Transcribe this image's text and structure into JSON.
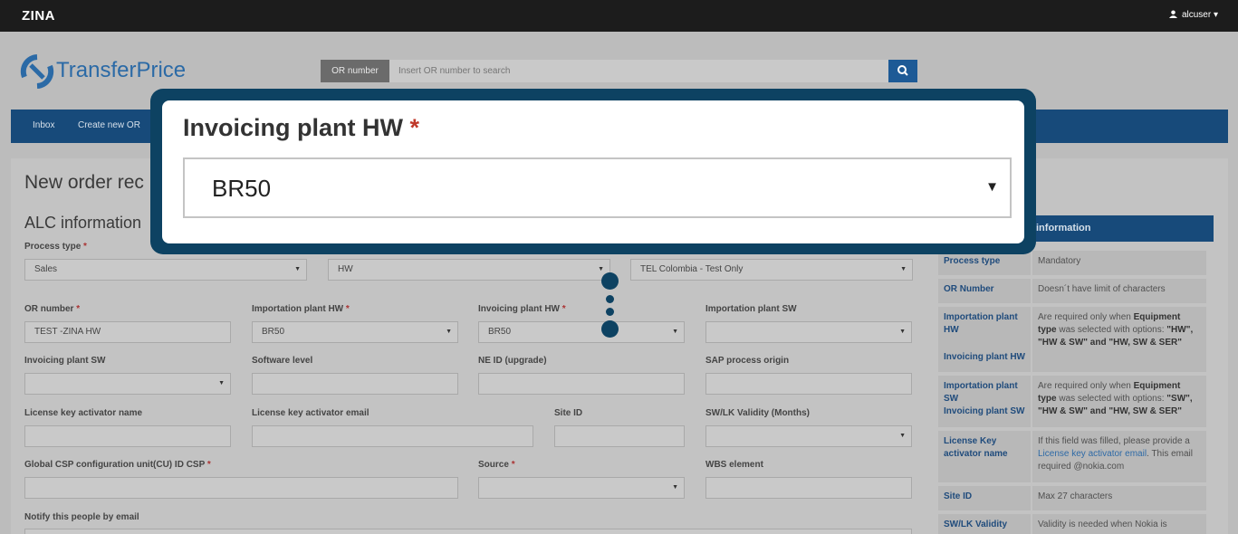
{
  "app": {
    "brand": "ZINA",
    "user": "alcuser ▾"
  },
  "logo": {
    "part1": "Transfer",
    "part2": "Price"
  },
  "search": {
    "label": "OR number",
    "placeholder": "Insert OR number to search"
  },
  "nav": {
    "items": [
      "Inbox",
      "Create new OR"
    ]
  },
  "page": {
    "title": "New order rec",
    "section": "ALC information"
  },
  "form": {
    "process_type": {
      "label": "Process type",
      "value": "Sales"
    },
    "equipment_type": {
      "value": "HW"
    },
    "customer": {
      "value": "TEL Colombia - Test Only"
    },
    "or_number": {
      "label": "OR number",
      "value": "TEST -ZINA HW"
    },
    "importation_plant_hw": {
      "label": "Importation plant HW",
      "value": "BR50"
    },
    "invoicing_plant_hw": {
      "label": "Invoicing plant HW",
      "value": "BR50"
    },
    "importation_plant_sw": {
      "label": "Importation plant SW",
      "value": ""
    },
    "invoicing_plant_sw": {
      "label": "Invoicing plant SW",
      "value": ""
    },
    "software_level": {
      "label": "Software level",
      "value": ""
    },
    "ne_id": {
      "label": "NE ID (upgrade)",
      "value": ""
    },
    "sap_origin": {
      "label": "SAP process origin",
      "value": ""
    },
    "lk_activator_name": {
      "label": "License key activator name",
      "value": ""
    },
    "lk_activator_email": {
      "label": "License key activator email",
      "value": ""
    },
    "site_id": {
      "label": "Site ID",
      "value": ""
    },
    "sw_lk_validity": {
      "label": "SW/LK Validity (Months)",
      "value": ""
    },
    "global_csp": {
      "label": "Global CSP configuration unit(CU) ID CSP",
      "value": ""
    },
    "source": {
      "label": "Source",
      "value": ""
    },
    "wbs": {
      "label": "WBS element",
      "value": ""
    },
    "notify": {
      "label": "Notify this people by email"
    }
  },
  "required_mark": "*",
  "info": {
    "header": "information",
    "rows": [
      {
        "key": "Process type",
        "value": "Mandatory"
      },
      {
        "key": "OR Number",
        "value": "Doesn´t have limit of characters"
      },
      {
        "key": "Importation plant HW",
        "v1": "Are required only when ",
        "v2": "Equipment type",
        "v3": " was selected with options: ",
        "v4": "\"HW\", \"HW & SW\" and \"HW, SW & SER\""
      },
      {
        "key": "Invoicing plant HW"
      },
      {
        "key": "Importation plant SW",
        "v1": "Are required only when ",
        "v2": "Equipment type",
        "v3": " was selected with options: ",
        "v4": "\"SW\", \"HW & SW\" and \"HW, SW & SER\""
      },
      {
        "key": "Invoicing plant SW"
      },
      {
        "key": "License Key activator name",
        "v1": "If this field was filled, please provide a ",
        "v2": "License key activator email",
        "v3": ". This email required @nokia.com"
      },
      {
        "key": "Site ID",
        "value": "Max 27 characters"
      },
      {
        "key": "SW/LK Validity",
        "value": "Validity is needed when Nokia is"
      }
    ]
  },
  "callout": {
    "label": "Invoicing plant HW",
    "value": "BR50"
  },
  "colors": {
    "navy": "#174a7a",
    "callout_border": "#0d4262",
    "required": "#c0392b"
  }
}
